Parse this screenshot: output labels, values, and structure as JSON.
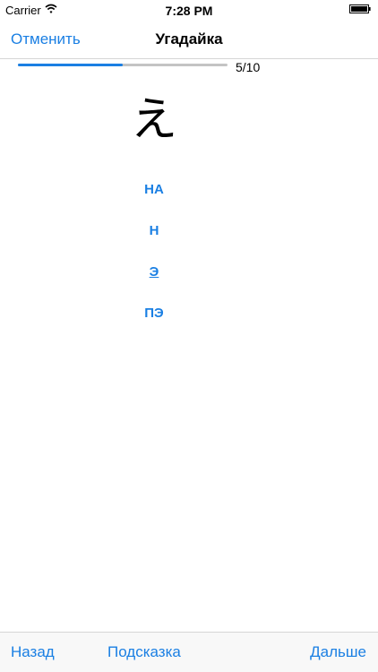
{
  "status_bar": {
    "carrier": "Carrier",
    "time": "7:28 PM"
  },
  "nav": {
    "cancel_label": "Отменить",
    "title": "Угадайка"
  },
  "progress": {
    "current": 5,
    "total": 10,
    "label": "5/10"
  },
  "question": {
    "kana": "え"
  },
  "options": [
    {
      "label": "НА"
    },
    {
      "label": "Н"
    },
    {
      "label": "Э"
    },
    {
      "label": "ПЭ"
    }
  ],
  "toolbar": {
    "back_label": "Назад",
    "hint_label": "Подсказка",
    "next_label": "Дальше"
  },
  "colors": {
    "accent": "#1a7fe3",
    "track": "#c4c4c4"
  }
}
